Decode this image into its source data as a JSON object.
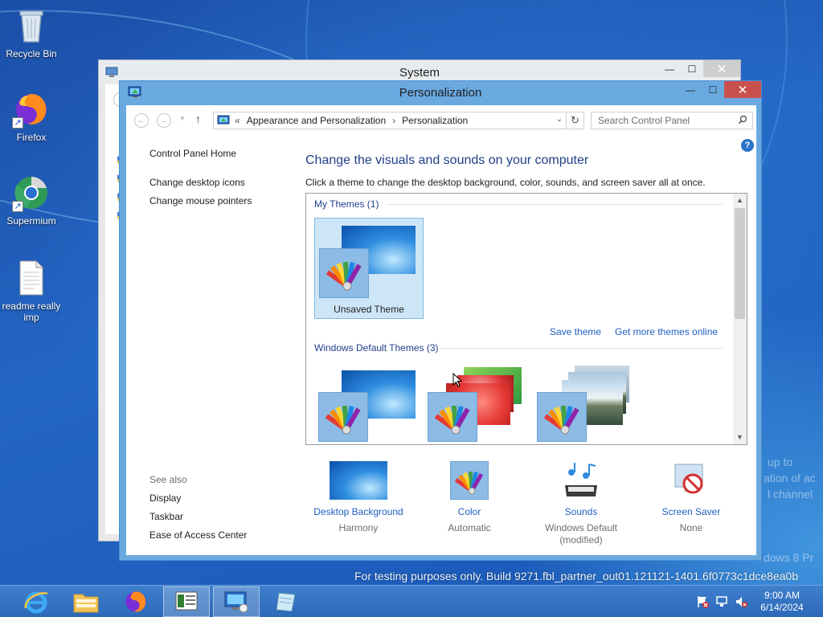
{
  "desktop": {
    "icons": [
      {
        "label": "Recycle Bin",
        "icon": "recycle-bin-icon"
      },
      {
        "label": "Firefox",
        "icon": "firefox-icon"
      },
      {
        "label": "Supermium",
        "icon": "supermium-icon"
      },
      {
        "label": "readme really imp",
        "icon": "text-document-icon"
      }
    ],
    "watermark": "For testing purposes only. Build 9271.fbl_partner_out01.121121-1401.6f0773c1dce8ea0b",
    "ghost_lines": [
      "up to",
      "ation of ac",
      "l channel",
      "dows 8 Pr"
    ]
  },
  "system_window": {
    "title": "System"
  },
  "personalization_window": {
    "title": "Personalization",
    "address": {
      "prefix": "«",
      "crumb1": "Appearance and Personalization",
      "separator": "›",
      "crumb2": "Personalization"
    },
    "search_placeholder": "Search Control Panel",
    "help": "?",
    "left_nav": {
      "home": "Control Panel Home",
      "desktop_icons": "Change desktop icons",
      "mouse_pointers": "Change mouse pointers",
      "see_also": "See also",
      "display": "Display",
      "taskbar": "Taskbar",
      "ease_of_access": "Ease of Access Center"
    },
    "heading": "Change the visuals and sounds on your computer",
    "subtext": "Click a theme to change the desktop background, color, sounds, and screen saver all at once.",
    "my_themes": {
      "label": "My Themes (1)",
      "tile_label": "Unsaved Theme",
      "save_link": "Save theme",
      "more_link": "Get more themes online"
    },
    "default_themes": {
      "label": "Windows Default Themes (3)"
    },
    "bottom": {
      "background": {
        "link": "Desktop Background",
        "value": "Harmony"
      },
      "color": {
        "link": "Color",
        "value": "Automatic"
      },
      "sounds": {
        "link": "Sounds",
        "value": "Windows Default",
        "value2": "(modified)"
      },
      "screensaver": {
        "link": "Screen Saver",
        "value": "None"
      }
    }
  },
  "taskbar": {
    "time": "9:00 AM",
    "date": "6/14/2024"
  },
  "colors": {
    "accent_link": "#1f5fbf",
    "heading": "#1f3f8a",
    "title_bar": "#6aa9e0",
    "close_button": "#c9514d"
  }
}
